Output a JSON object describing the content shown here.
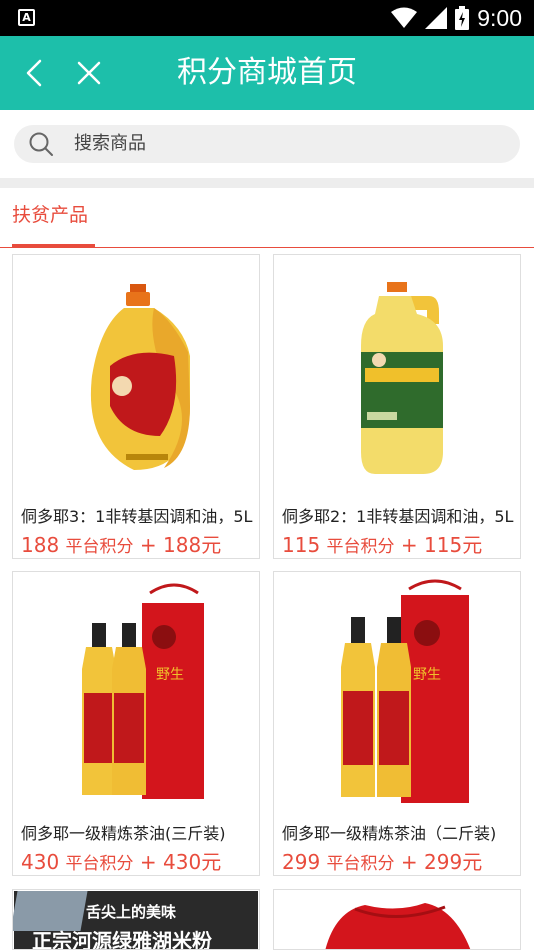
{
  "status_bar": {
    "time": "9:00",
    "left_icon": "A"
  },
  "header": {
    "title": "积分商城首页"
  },
  "search": {
    "placeholder": "搜索商品"
  },
  "tabs": [
    {
      "label": "扶贫产品"
    }
  ],
  "products": [
    {
      "name": "侗多耶3：1非转基因调和油，5L",
      "price": "188",
      "points_label": "平台积分",
      "plus": "+",
      "yuan": "188元"
    },
    {
      "name": "侗多耶2：1非转基因调和油，5L",
      "price": "115",
      "points_label": "平台积分",
      "plus": "+",
      "yuan": "115元"
    },
    {
      "name": "侗多耶一级精炼茶油(三斤装)",
      "price": "430",
      "points_label": "平台积分",
      "plus": "+",
      "yuan": "430元"
    },
    {
      "name": "侗多耶一级精炼茶油（二斤装)",
      "price": "299",
      "points_label": "平台积分",
      "plus": "+",
      "yuan": "299元"
    }
  ],
  "banner_text": {
    "line1": "舌尖上的美味",
    "line2": "正宗河源绿雅湖米粉"
  },
  "colors": {
    "primary": "#1dbfaa",
    "accent": "#e84c3d"
  }
}
